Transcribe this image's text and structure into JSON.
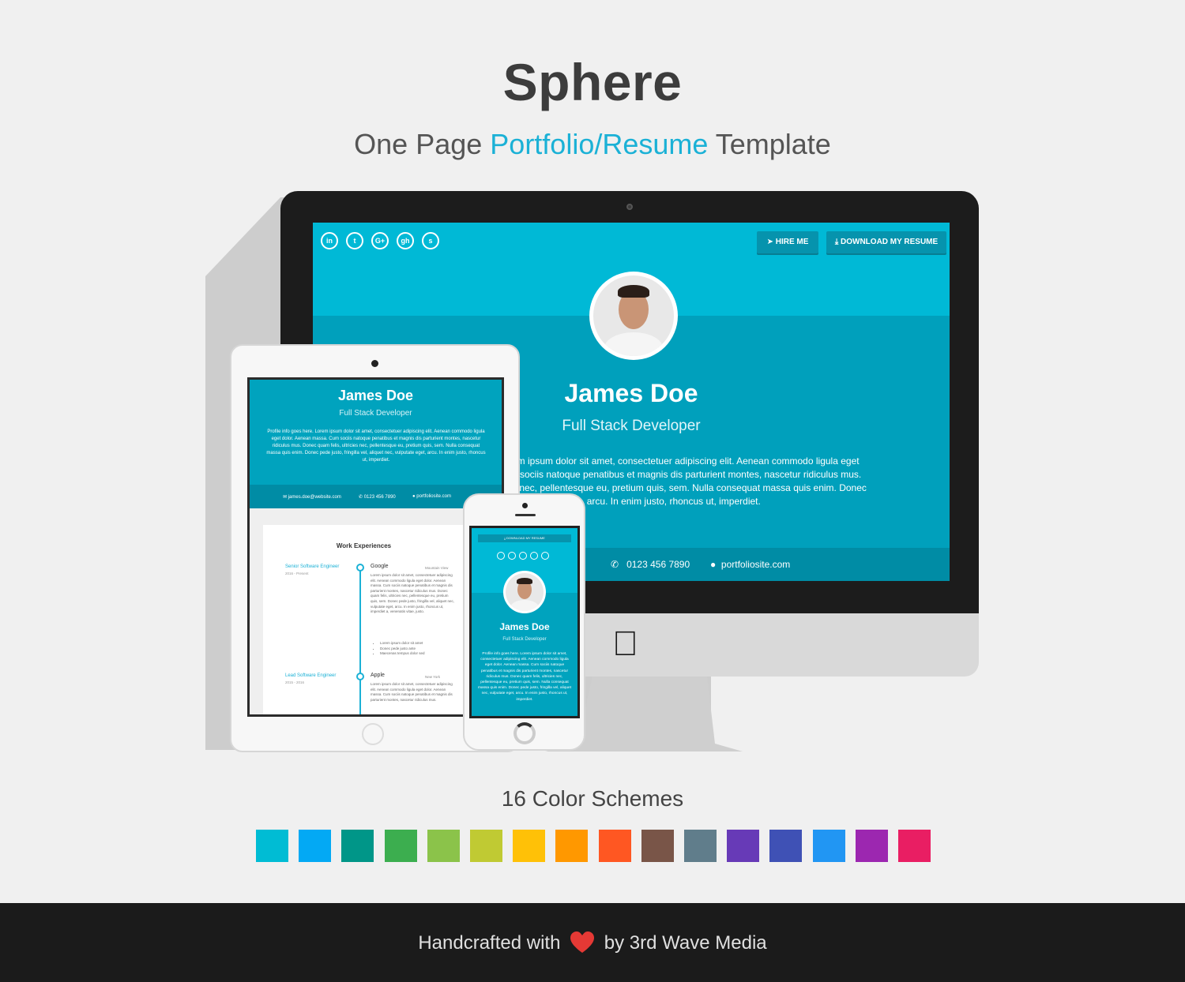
{
  "header": {
    "title": "Sphere",
    "subtitle_pre": "One Page ",
    "subtitle_hl": "Portfolio/Resume",
    "subtitle_post": " Template",
    "accent_color": "#1bb1d6"
  },
  "desktop": {
    "social_icons": [
      "in",
      "t",
      "G+",
      "gh",
      "s"
    ],
    "social_icon_names": [
      "linkedin-icon",
      "twitter-icon",
      "google-plus-icon",
      "github-icon",
      "skype-icon"
    ],
    "hire_label": "HIRE ME",
    "download_label": "DOWNLOAD MY RESUME",
    "name": "James Doe",
    "role": "Full Stack Developer",
    "bio_lines": [
      "em ipsum dolor sit amet, consectetuer adipiscing elit. Aenean commodo ligula eget",
      "n sociis natoque penatibus et magnis dis parturient montes, nascetur ridiculus mus.",
      "s nec, pellentesque eu, pretium quis, sem. Nulla consequat massa quis enim. Donec",
      "c, vulputate eget, arcu. In enim justo, rhoncus ut, imperdiet."
    ],
    "phone": "0123 456 7890",
    "website": "portfoliosite.com",
    "screen_color": "#00a0bc"
  },
  "tablet": {
    "name": "James Doe",
    "role": "Full Stack Developer",
    "bio": "Profile info goes here. Lorem ipsum dolor sit amet, consectetuer adipiscing elit. Aenean commodo ligula eget dolor. Aenean massa. Cum sociis natoque penatibus et magnis dis parturient montes, nascetur ridiculus mus. Donec quam felis, ultricies nec, pellentesque eu, pretium quis, sem. Nulla consequat massa quis enim. Donec pede justo, fringilla vel, aliquet nec, vulputate eget, arcu. In enim justo, rhoncus ut, imperdiet.",
    "email": "james.doe@website.com",
    "phone": "0123 456 7890",
    "website": "portfoliosite.com",
    "section_title": "Work Experiences",
    "jobs": [
      {
        "title": "Senior Software Engineer",
        "dates": "2016 - Present",
        "company": "Google",
        "location": "Mountain View",
        "desc": "Lorem ipsum dolor sit amet, consectetuer adipiscing elit. Aenean commodo ligula eget dolor. Aenean massa. Cum sociis natoque penatibus et magnis dis parturient montes, nascetur ridiculus mus. Donec quam felis, ultricies nec, pellentesque eu, pretium quis, sem. Donec pede justo, fringilla vel, aliquet nec, vulputate eget, arcu. In enim justo, rhoncus ut, imperdiet a, venenatis vitae, justo.",
        "bullets": [
          "Lorem ipsum dolor sit amet",
          "Donec pede justo ante",
          "Maecenas tempus dolor sed"
        ]
      },
      {
        "title": "Lead Software Engineer",
        "dates": "2015 - 2016",
        "company": "Apple",
        "location": "New York",
        "desc": "Lorem ipsum dolor sit amet, consectetuer adipiscing elit. Aenean commodo ligula eget dolor. Aenean massa. Cum sociis natoque penatibus et magnis dis parturient montes, nascetur ridiculus mus."
      }
    ]
  },
  "phone": {
    "download_label": "DOWNLOAD MY RESUME",
    "name": "James Doe",
    "role": "Full Stack Developer",
    "bio": "Profile info goes here. Lorem ipsum dolor sit amet, consectetuer adipiscing elit. Aenean commodo ligula eget dolor. Aenean massa. Cum sociis natoque penatibus et magnis dis parturient montes, nascetur ridiculus mus. Donec quam felis, ultricies nec, pellentesque eu, pretium quis, sem. Nulla consequat massa quis enim. Donec pede justo, fringilla vel, aliquet nec, vulputate eget, arcu. In enim justo, rhoncus ut, imperdiet."
  },
  "color_schemes": {
    "label": "16 Color Schemes",
    "colors": [
      "#00bcd4",
      "#03a9f4",
      "#009688",
      "#3cae4f",
      "#8bc34a",
      "#c0ca33",
      "#ffc107",
      "#ff9800",
      "#ff5722",
      "#795548",
      "#607d8b",
      "#673ab7",
      "#3f51b5",
      "#2196f3",
      "#9c27b0",
      "#e91e63"
    ]
  },
  "footer": {
    "pre": "Handcrafted with",
    "post": "by 3rd Wave Media",
    "heart_color": "#e53935"
  }
}
